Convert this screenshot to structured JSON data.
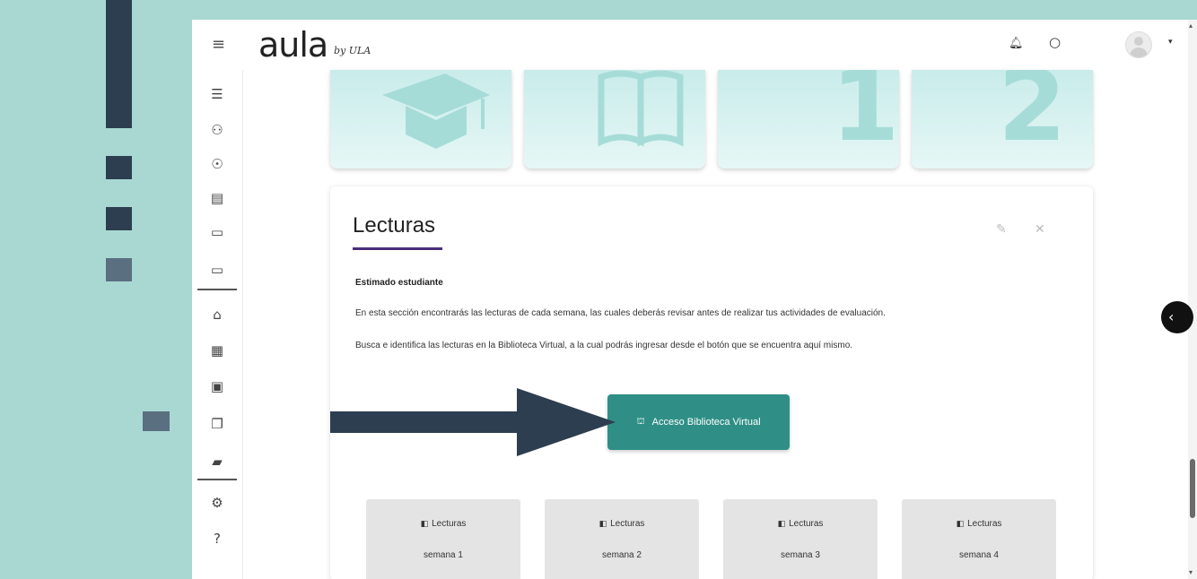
{
  "header": {
    "menu_icon": "hamburger-icon",
    "logo_main": "aula",
    "logo_sub": "by ULA",
    "notification_icon": "bell-icon",
    "messages_icon": "chat-icon",
    "user_menu_icon": "caret-down-icon"
  },
  "sidenav": {
    "items": [
      {
        "icon": "list-icon"
      },
      {
        "icon": "user-icon"
      },
      {
        "icon": "medal-icon"
      },
      {
        "icon": "gradebook-icon"
      },
      {
        "icon": "folder-icon"
      },
      {
        "icon": "folder-icon"
      },
      {
        "icon": "home-icon"
      },
      {
        "icon": "dashboard-icon"
      },
      {
        "icon": "calendar-icon"
      },
      {
        "icon": "documents-icon"
      },
      {
        "icon": "folder-open-icon"
      },
      {
        "icon": "settings-icon"
      },
      {
        "icon": "help-icon"
      }
    ]
  },
  "banners": [
    {
      "icon": "graduation-cap-icon"
    },
    {
      "icon": "open-book-icon"
    },
    {
      "glyph": "1"
    },
    {
      "glyph": "2"
    }
  ],
  "lecturas": {
    "title": "Lecturas",
    "subtitle": "Estimado estudiante",
    "paragraph_1": "En esta sección encontrarás las lecturas de cada semana, las cuales deberás revisar antes de realizar tus actividades de evaluación.",
    "paragraph_2": "Busca e identifica las lecturas en la Biblioteca Virtual, a la cual podrás ingresar desde el botón que se encuentra aquí mismo.",
    "access_button": {
      "icon": "library-icon",
      "label": "Acceso Biblioteca Virtual"
    },
    "weeks": [
      {
        "label": "Lecturas",
        "week": "semana 1"
      },
      {
        "label": "Lecturas",
        "week": "semana 2"
      },
      {
        "label": "Lecturas",
        "week": "semana 3"
      },
      {
        "label": "Lecturas",
        "week": "semana 4"
      }
    ]
  },
  "colors": {
    "page_background": "#a9d8d3",
    "decoration": "#2c3e50",
    "accent_button": "#2f8f86",
    "title_underline": "#4b2e7a",
    "tile_background": "#e4e4e4"
  }
}
